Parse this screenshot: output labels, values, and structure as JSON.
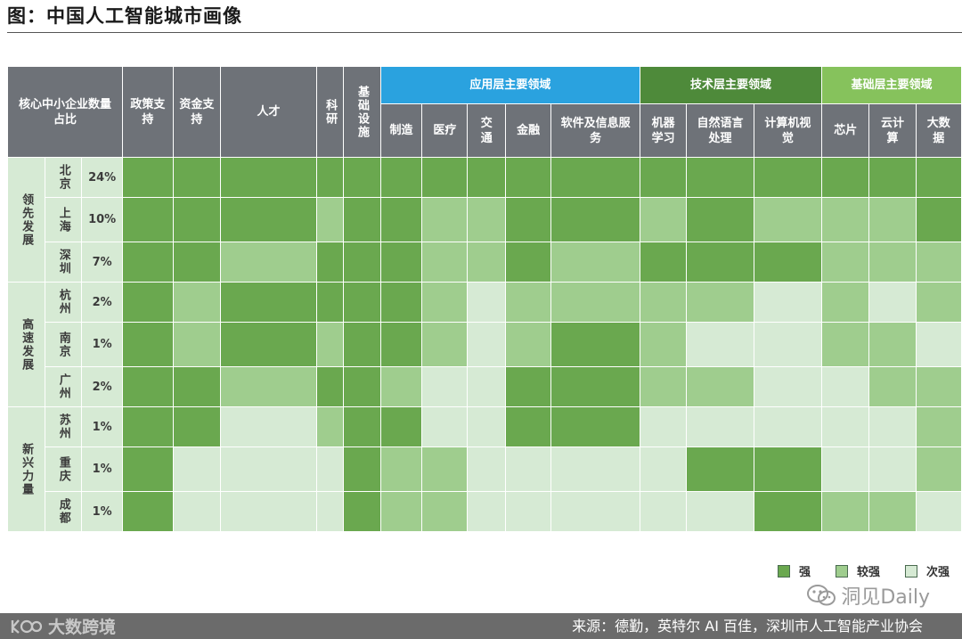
{
  "title": "图：中国人工智能城市画像",
  "colors": {
    "strong": "#6aa84f",
    "medium": "#9fcd8e",
    "weak": "#d6ead4"
  },
  "chart_data": {
    "type": "heatmap",
    "title": "图：中国人工智能城市画像",
    "header": {
      "share_label": "核心中小企业数量占比",
      "general_columns": [
        "政策支持",
        "资金支持",
        "人才",
        "科研",
        "基础设施"
      ],
      "groups": [
        {
          "name": "应用层主要领域",
          "columns": [
            "制造",
            "医疗",
            "交通",
            "金融",
            "软件及信息服务"
          ]
        },
        {
          "name": "技术层主要领域",
          "columns": [
            "机器学习",
            "自然语言处理",
            "计算机视觉"
          ]
        },
        {
          "name": "基础层主要领域",
          "columns": [
            "芯片",
            "云计算",
            "大数据"
          ]
        }
      ]
    },
    "row_groups": [
      {
        "name": "领先发展",
        "rows": [
          {
            "city": "北京",
            "share": "24%",
            "values": [
              "强",
              "强",
              "强",
              "强",
              "强",
              "强",
              "强",
              "强",
              "强",
              "强",
              "强",
              "强",
              "强",
              "强",
              "强",
              "强"
            ]
          },
          {
            "city": "上海",
            "share": "10%",
            "values": [
              "强",
              "强",
              "强",
              "较强",
              "强",
              "强",
              "较强",
              "较强",
              "强",
              "强",
              "较强",
              "强",
              "较强",
              "较强",
              "较强",
              "强"
            ]
          },
          {
            "city": "深圳",
            "share": "7%",
            "values": [
              "强",
              "强",
              "较强",
              "强",
              "强",
              "强",
              "较强",
              "较强",
              "强",
              "较强",
              "强",
              "强",
              "强",
              "较强",
              "较强",
              "较强"
            ]
          }
        ]
      },
      {
        "name": "高速发展",
        "rows": [
          {
            "city": "杭州",
            "share": "2%",
            "values": [
              "强",
              "较强",
              "强",
              "强",
              "强",
              "强",
              "较强",
              "次强",
              "较强",
              "较强",
              "较强",
              "较强",
              "次强",
              "较强",
              "次强",
              "较强"
            ]
          },
          {
            "city": "南京",
            "share": "1%",
            "values": [
              "强",
              "较强",
              "强",
              "较强",
              "强",
              "强",
              "较强",
              "次强",
              "较强",
              "强",
              "较强",
              "次强",
              "次强",
              "较强",
              "较强",
              "次强"
            ]
          },
          {
            "city": "广州",
            "share": "2%",
            "values": [
              "强",
              "强",
              "较强",
              "强",
              "强",
              "较强",
              "次强",
              "次强",
              "强",
              "强",
              "较强",
              "较强",
              "次强",
              "次强",
              "较强",
              "较强"
            ]
          }
        ]
      },
      {
        "name": "新兴力量",
        "rows": [
          {
            "city": "苏州",
            "share": "1%",
            "values": [
              "强",
              "强",
              "次强",
              "较强",
              "强",
              "强",
              "次强",
              "次强",
              "强",
              "强",
              "次强",
              "次强",
              "次强",
              "次强",
              "次强",
              "较强"
            ]
          },
          {
            "city": "重庆",
            "share": "1%",
            "values": [
              "强",
              "次强",
              "次强",
              "次强",
              "强",
              "较强",
              "较强",
              "次强",
              "次强",
              "次强",
              "次强",
              "强",
              "强",
              "次强",
              "次强",
              "较强"
            ]
          },
          {
            "city": "成都",
            "share": "1%",
            "values": [
              "强",
              "次强",
              "次强",
              "次强",
              "强",
              "较强",
              "较强",
              "次强",
              "次强",
              "次强",
              "次强",
              "次强",
              "强",
              "较强",
              "较强",
              "次强"
            ]
          }
        ]
      }
    ],
    "legend": [
      {
        "label": "强",
        "level": "strong"
      },
      {
        "label": "较强",
        "level": "medium"
      },
      {
        "label": "次强",
        "level": "weak"
      }
    ]
  },
  "watermark": {
    "text": "洞见Daily"
  },
  "footer": {
    "logo_text": "大数跨境",
    "source": "来源：德勤，英特尔 AI 百佳，深圳市人工智能产业协会"
  }
}
